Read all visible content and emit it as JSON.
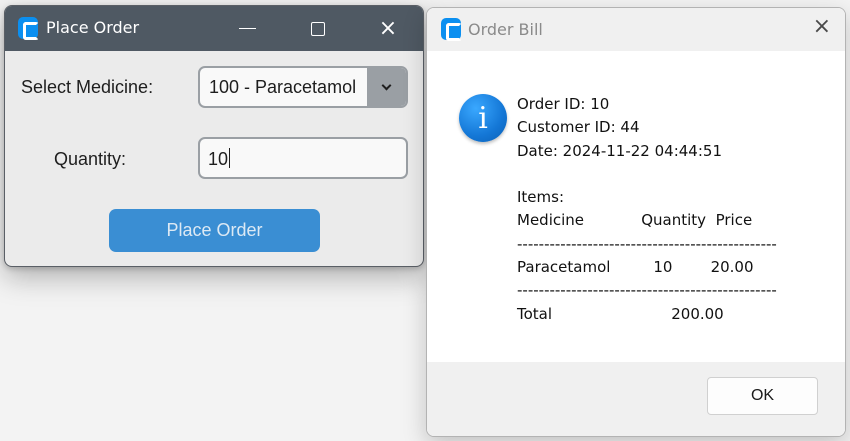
{
  "order_window": {
    "title": "Place Order",
    "icon": "app-icon",
    "controls": {
      "minimize": "minimize-icon",
      "maximize": "maximize-icon",
      "close": "×"
    },
    "medicine_label": "Select Medicine:",
    "medicine_selected": "100 - Paracetamol",
    "quantity_label": "Quantity:",
    "quantity_value": "10",
    "place_order_button": "Place Order",
    "colors": {
      "titlebar": "#4f5963",
      "button": "#3a8ed3",
      "button_text": "#dce9f4",
      "icon": "#0b8ff0"
    }
  },
  "bill_dialog": {
    "title": "Order Bill",
    "close": "×",
    "icon": "info-icon",
    "info_glyph": "i",
    "message": "Order ID: 10\nCustomer ID: 44\nDate: 2024-11-22 04:44:51\n\nItems:\nMedicine            Quantity  Price\n------------------------------------------------\nParacetamol         10        20.00\n------------------------------------------------\nTotal                         200.00",
    "ok_button": "OK",
    "colors": {
      "info_icon": "#1477d6",
      "footer": "#f0f0f0"
    }
  }
}
